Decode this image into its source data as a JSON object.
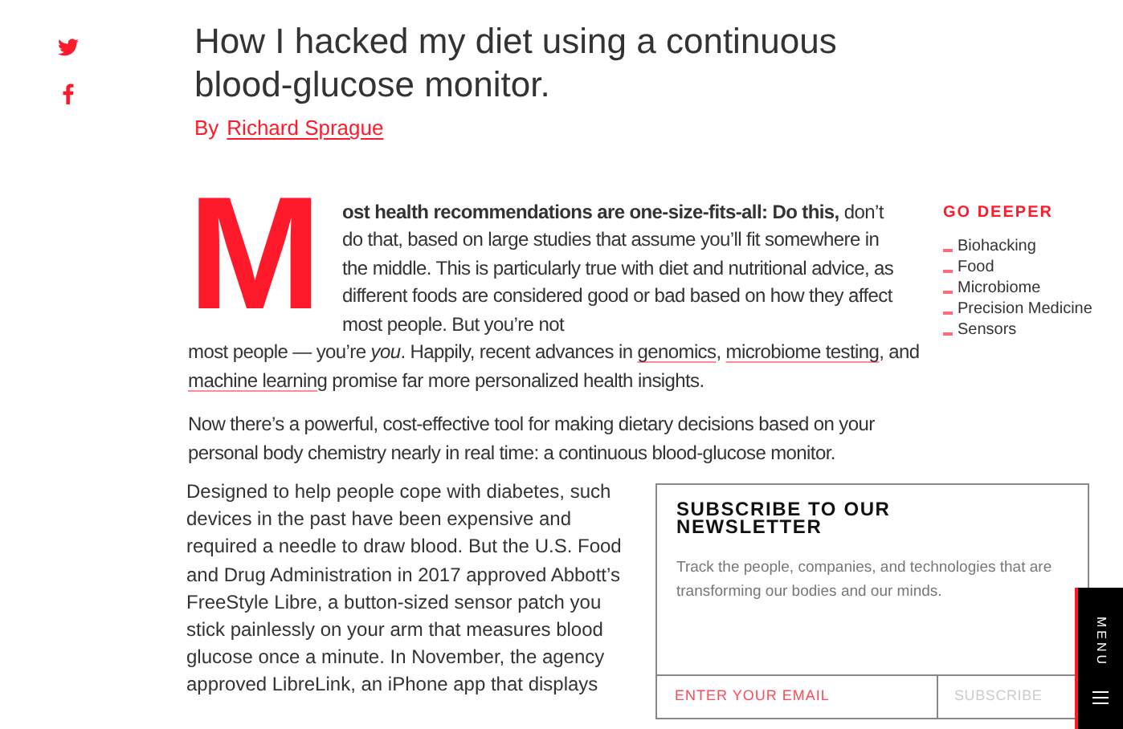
{
  "share": [
    {
      "kind": "twitter"
    },
    {
      "kind": "facebook"
    }
  ],
  "article": {
    "title": "How I hacked my diet using a continuous blood-glucose monitor.",
    "byline_prefix": "By",
    "author": "Richard Sprague",
    "drop_cap": "M",
    "lead": "**ost health recommendations are one-size-fits-all: Do this,** don’t do that, based on large studies that assume you’ll fit somewhere in the middle. This is particularly true with diet and nutritional advice, as different foods are considered good or bad based on how they affect most people. But you’re not",
    "paragraphs": [
      {
        "segments": [
          {
            "kind": "text",
            "text": "most people — you’re *you*. Happily, recent advances in "
          },
          {
            "kind": "link",
            "text": "genomics"
          },
          {
            "kind": "text",
            "text": ", "
          },
          {
            "kind": "link",
            "text": "microbiome testing"
          },
          {
            "kind": "text",
            "text": ", and "
          },
          {
            "kind": "link",
            "text": "machine learning"
          },
          {
            "kind": "text",
            "text": " promise far more personalized health insights."
          }
        ]
      },
      {
        "segments": [
          {
            "kind": "text",
            "text": "Now there’s a powerful, cost-effective tool for making dietary decisions based on your personal body chemistry nearly in real time: a continuous blood-glucose monitor."
          }
        ]
      },
      {
        "segments": [
          {
            "kind": "text",
            "text": "Designed to help people cope with diabetes, such devices in the past have been expensive and required a needle to draw blood. But the U.S. Food and Drug Administration in 2017 approved Abbott’s FreeStyle Libre, a button-sized sensor patch you stick painlessly on your arm that measures blood glucose once a minute. In November, the agency approved LibreLink, an iPhone app that displays"
          }
        ]
      }
    ]
  },
  "go_deeper": {
    "heading": "GO DEEPER",
    "items": [
      "Biohacking",
      "Food",
      "Microbiome",
      "Precision Medicine",
      "Sensors"
    ]
  },
  "newsletter": {
    "title": "SUBSCRIBE TO OUR NEWSLETTER",
    "description": "Track the people, companies, and technologies that are transforming our bodies and our minds.",
    "email_placeholder": "ENTER YOUR EMAIL",
    "button": "SUBSCRIBE"
  },
  "menu": {
    "label": "MENU"
  }
}
